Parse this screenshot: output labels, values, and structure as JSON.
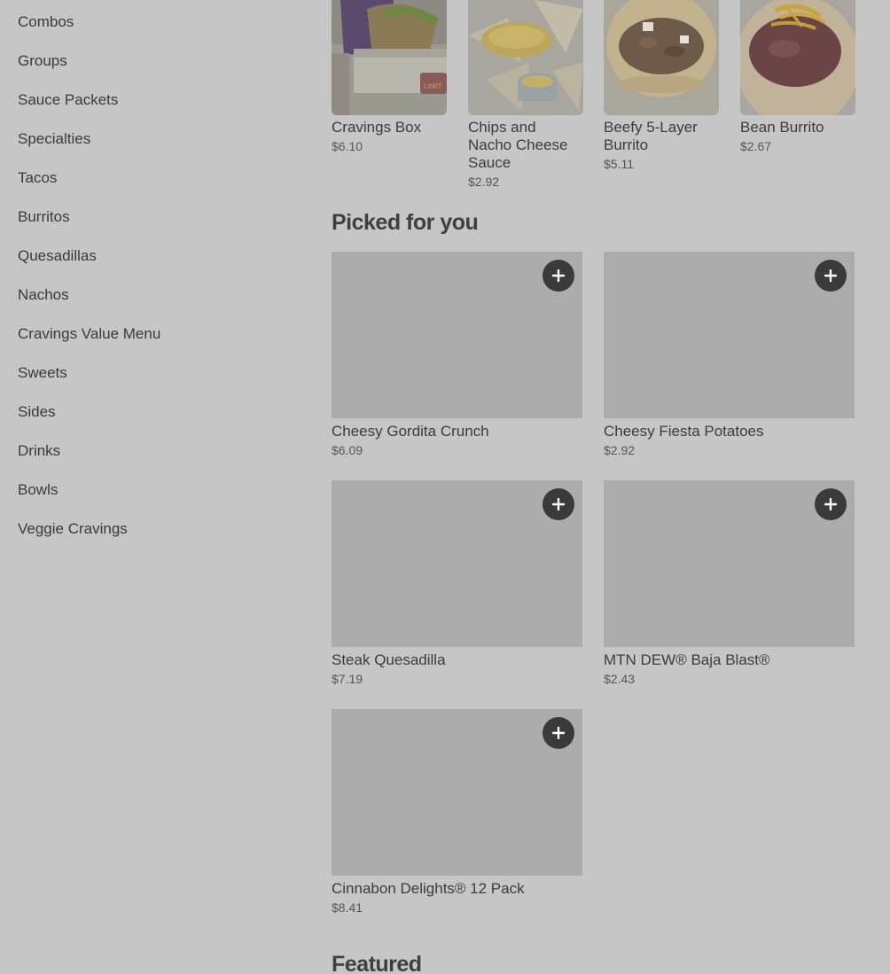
{
  "sidebar": {
    "items": [
      {
        "label": "Combos"
      },
      {
        "label": "Groups"
      },
      {
        "label": "Sauce Packets"
      },
      {
        "label": "Specialties"
      },
      {
        "label": "Tacos"
      },
      {
        "label": "Burritos"
      },
      {
        "label": "Quesadillas"
      },
      {
        "label": "Nachos"
      },
      {
        "label": "Cravings Value Menu"
      },
      {
        "label": "Sweets"
      },
      {
        "label": "Sides"
      },
      {
        "label": "Drinks"
      },
      {
        "label": "Bowls"
      },
      {
        "label": "Veggie Cravings"
      }
    ]
  },
  "top_items": [
    {
      "name": "Cravings Box",
      "price": "$6.10",
      "badge": "LIMIT"
    },
    {
      "name": "Chips and Nacho Cheese Sauce",
      "price": "$2.92"
    },
    {
      "name": "Beefy 5-Layer Burrito",
      "price": "$5.11"
    },
    {
      "name": "Bean Burrito",
      "price": "$2.67"
    }
  ],
  "picked_for_you": {
    "title": "Picked for you",
    "items": [
      {
        "name": "Cheesy Gordita Crunch",
        "price": "$6.09"
      },
      {
        "name": "Cheesy Fiesta Potatoes",
        "price": "$2.92"
      },
      {
        "name": "Steak Quesadilla",
        "price": "$7.19"
      },
      {
        "name": "MTN DEW® Baja Blast®",
        "price": "$2.43"
      },
      {
        "name": "Cinnabon Delights® 12 Pack",
        "price": "$8.41"
      }
    ]
  },
  "featured": {
    "title": "Featured"
  },
  "icons": {
    "add": "plus-icon"
  },
  "colors": {
    "overlay_bg": "#c6c6c6",
    "placeholder": "#acacac",
    "add_button": "#3a3a3a"
  }
}
